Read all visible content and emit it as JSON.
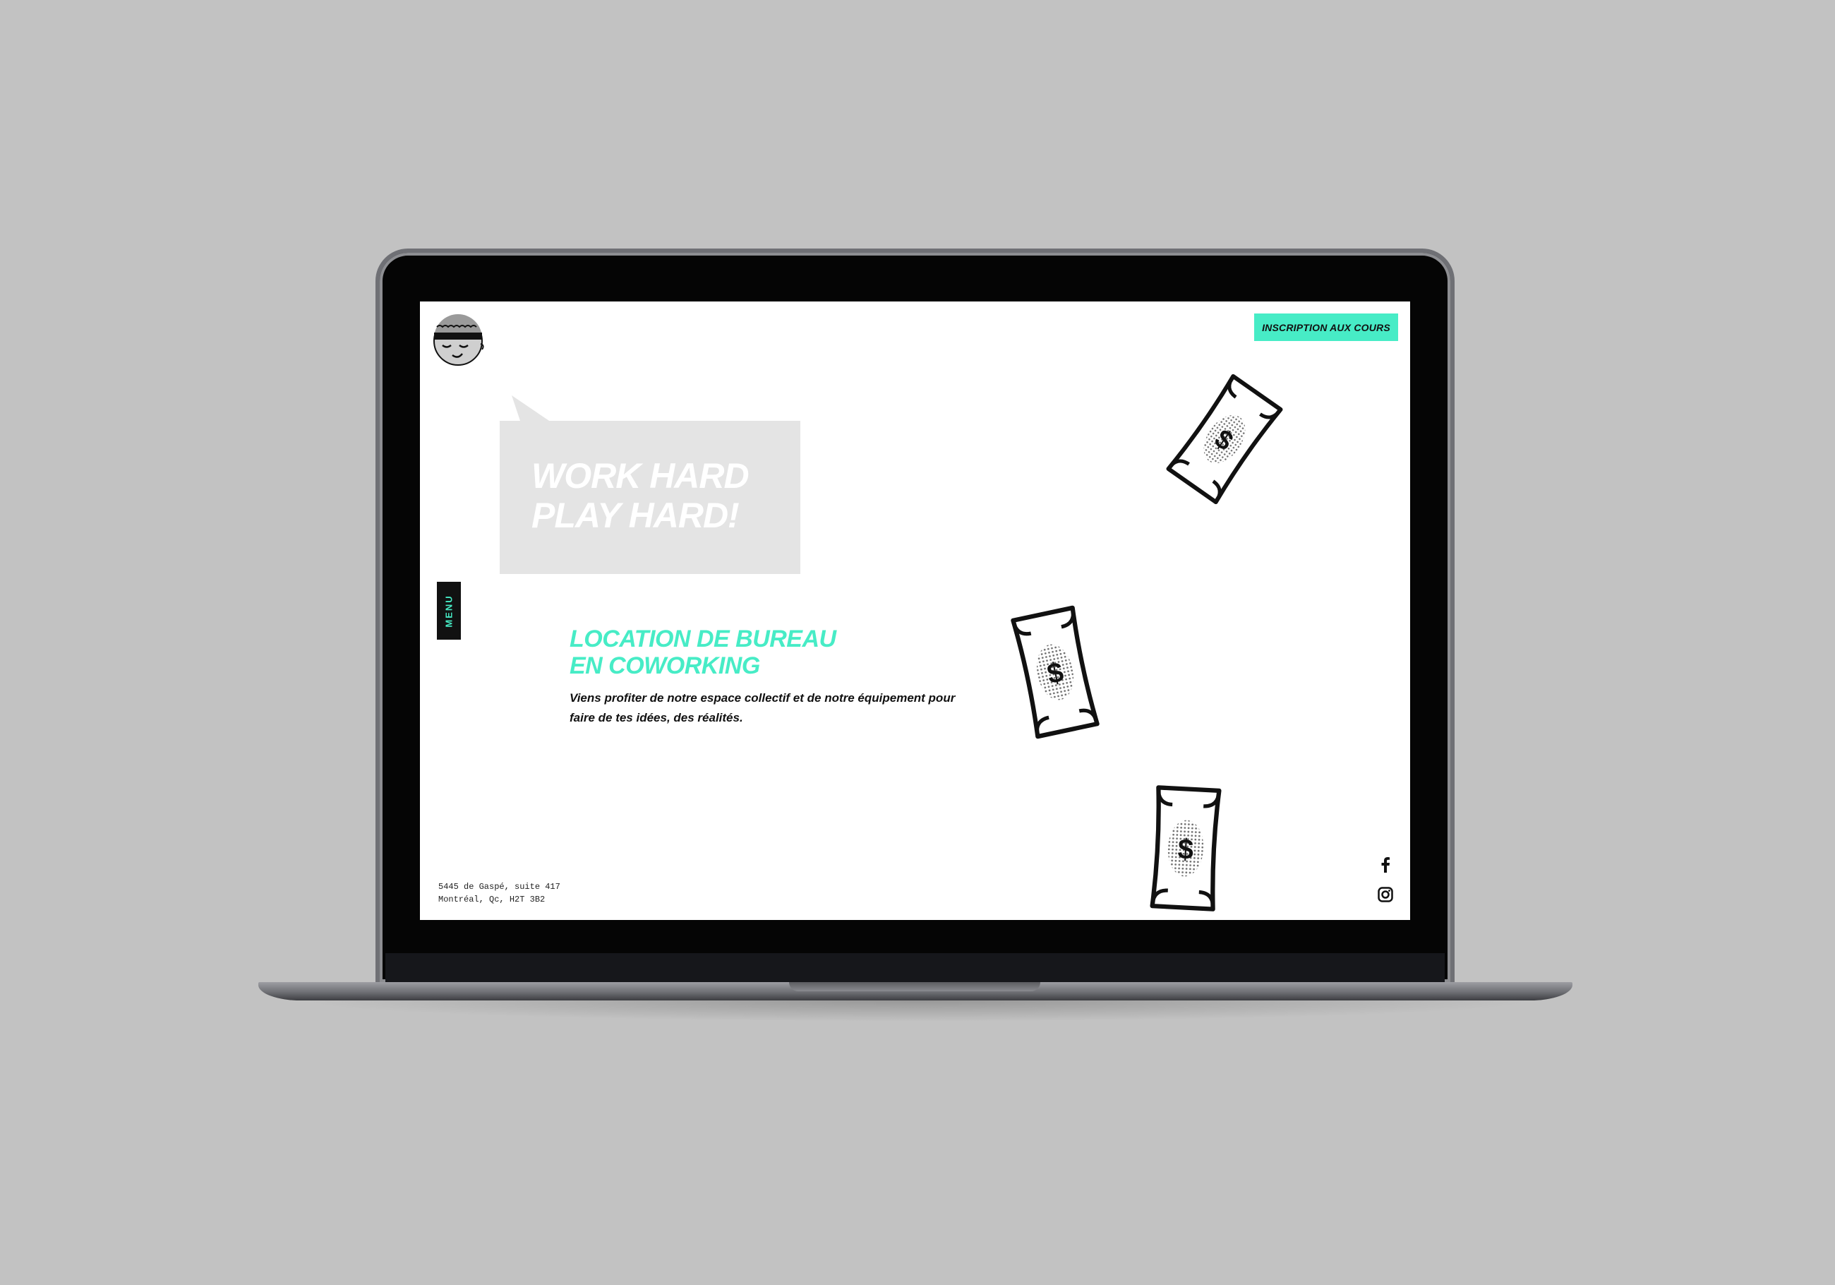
{
  "header": {
    "cta_label": "INSCRIPTION AUX COURS"
  },
  "hero": {
    "bubble_line1": "WORK HARD",
    "bubble_line2": "PLAY HARD!"
  },
  "sidebar": {
    "menu_label": "MENU"
  },
  "content": {
    "heading_line1": "LOCATION DE BUREAU",
    "heading_line2": "EN COWORKING",
    "description": "Viens profiter de notre espace collectif et de notre équipement pour faire de tes idées, des réalités."
  },
  "footer": {
    "address_line1": "5445 de Gaspé, suite 417",
    "address_line2": "Montréal, Qc, H2T 3B2"
  },
  "social": {
    "icons": [
      "facebook-icon",
      "instagram-icon"
    ]
  },
  "colors": {
    "accent": "#47ecc6",
    "bubble": "#e4e4e4",
    "page_background": "#c2c2c2",
    "text": "#111111"
  }
}
